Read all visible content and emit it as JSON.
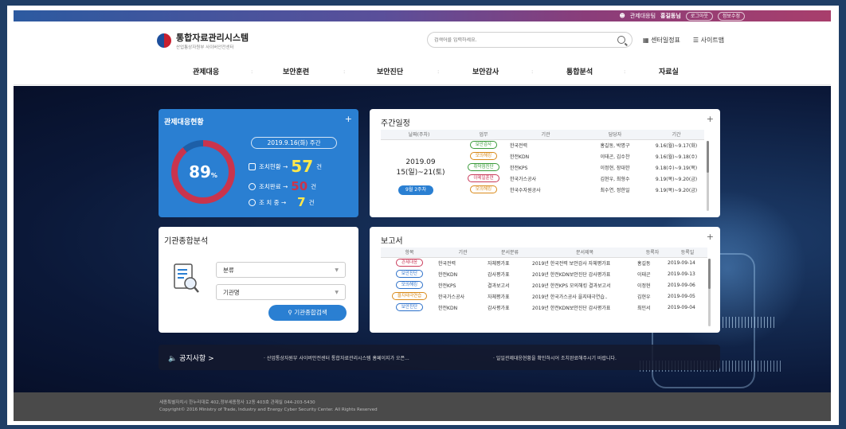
{
  "topbar": {
    "user_label": "관제대응팀",
    "user_name": "홍길동님",
    "logout": "로그아웃",
    "profile": "정보수정"
  },
  "header": {
    "logo_title": "통합자료관리시스템",
    "logo_sub": "산업통상자원부 사이버안전센터",
    "search_placeholder": "검색어를 입력하세요.",
    "link_schedule": "센터일정표",
    "link_sitemap": "사이트맵"
  },
  "gnb": [
    "관제대응",
    "보안훈련",
    "보안진단",
    "보안감사",
    "통합분석",
    "자료실"
  ],
  "status": {
    "title": "관제대응현황",
    "percent": "89",
    "percent_unit": "%",
    "week": "2019.9.16(화) 주간",
    "rows": [
      {
        "label": "조치현황 →",
        "value": "57",
        "unit": "건"
      },
      {
        "label": "조치완료 →",
        "value": "50",
        "unit": "건"
      },
      {
        "label": "조 치 중 →",
        "value": "7",
        "unit": "건"
      }
    ]
  },
  "weekly": {
    "title": "주간일정",
    "headers": [
      "날짜(주차)",
      "업무",
      "기관",
      "담당자",
      "기간"
    ],
    "date": "2019.09 15(일)~21(토)",
    "week_badge": "9월 2주차",
    "rows": [
      {
        "tag": "보안감사",
        "color": "#3a9a3a",
        "org": "한국전력",
        "person": "홍길동, 박명구",
        "period": "9.16(월)~9.17(화)"
      },
      {
        "tag": "모의해킹",
        "color": "#d98a1a",
        "org": "한전KDN",
        "person": "이태곤, 김수찬",
        "period": "9.16(월)~9.18(수)"
      },
      {
        "tag": "취약점진단",
        "color": "#3a9a3a",
        "org": "한전KPS",
        "person": "이정현, 장대한",
        "period": "9.18(수)~9.19(목)"
      },
      {
        "tag": "이메일훈련",
        "color": "#c93a5a",
        "org": "한국가스공사",
        "person": "김현우, 최형수",
        "period": "9.19(목)~9.20(금)"
      },
      {
        "tag": "모의해킹",
        "color": "#d98a1a",
        "org": "한국수자원공사",
        "person": "최수연, 정한일",
        "period": "9.19(목)~9.20(금)"
      }
    ]
  },
  "analysis": {
    "title": "기관종합분석",
    "select1": "분류",
    "select2": "기관명",
    "button": "기관종합검색"
  },
  "report": {
    "title": "보고서",
    "headers": [
      "항목",
      "기관",
      "문서분류",
      "문서제목",
      "등록자",
      "등록일"
    ],
    "rows": [
      {
        "tag": "관제대응",
        "color": "#c93a5a",
        "org": "한국전력",
        "cat": "자체평가표",
        "doc": "2019년 한국전력 보안감사 자체평가표",
        "author": "홍길동",
        "date": "2019-09-14"
      },
      {
        "tag": "보안진단",
        "color": "#2a6fc9",
        "org": "한전KDN",
        "cat": "감사평가표",
        "doc": "2019년 한전KDN보안진단 감사평가표",
        "author": "이태곤",
        "date": "2019-09-13"
      },
      {
        "tag": "모의해킹",
        "color": "#2a6fc9",
        "org": "한전KPS",
        "cat": "결과보고서",
        "doc": "2019년 한전KPS 모의해킹 결과보고서",
        "author": "이정현",
        "date": "2019-09-06"
      },
      {
        "tag": "을지태극연습",
        "color": "#d98a1a",
        "org": "한국가스공사",
        "cat": "자체평가표",
        "doc": "2019년 한국가스공사 을지태극연습..",
        "author": "김현우",
        "date": "2019-09-05"
      },
      {
        "tag": "보안진단",
        "color": "#2a6fc9",
        "org": "한전KDN",
        "cat": "감사평가표",
        "doc": "2019년 한전KDN보안진단 감사평가표",
        "author": "최민서",
        "date": "2019-09-04"
      }
    ]
  },
  "notice": {
    "label": "공지사항 >",
    "msg1": "· 산업통상자원부 사이버안전센터 통합자료관리시스템 홈페이지가 오픈...",
    "msg2": "· 일일관제대응현황을 확인하시어 조치완료해주시기 바랍니다."
  },
  "footer": {
    "address": "세종특별자치시 한누리대로 402,정부세종청사 12동 403호 관제실 044-203-5430",
    "copyright": "Copyright© 2016 Ministry of Trade, Industry and Energy Cyber Security Center. All Rights Reserved"
  }
}
